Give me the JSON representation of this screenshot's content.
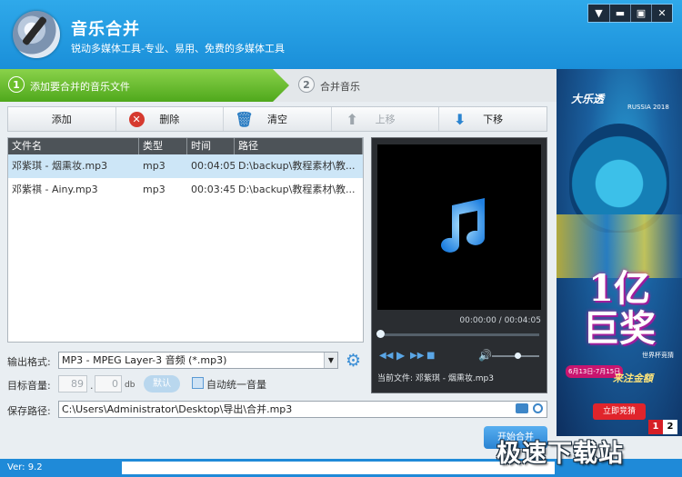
{
  "app": {
    "title": "音乐合并",
    "subtitle": "锐动多媒体工具-专业、易用、免费的多媒体工具"
  },
  "window_controls": {
    "menu_icon": "menu-icon",
    "minimize_icon": "minimize-icon",
    "maximize_icon": "maximize-icon",
    "close_icon": "close-icon"
  },
  "steps": [
    {
      "number": "1",
      "label": "添加要合并的音乐文件",
      "active": true
    },
    {
      "number": "2",
      "label": "合并音乐",
      "active": false
    }
  ],
  "toolbar": {
    "add": "添加",
    "delete": "删除",
    "clear": "清空",
    "move_up": "上移",
    "move_down": "下移"
  },
  "file_list": {
    "headers": [
      "文件名",
      "类型",
      "时间",
      "路径"
    ],
    "rows": [
      {
        "name": "邓紫琪 - 烟熏妆.mp3",
        "type": "mp3",
        "time": "00:04:05",
        "path": "D:\\backup\\教程素材\\教...",
        "selected": true
      },
      {
        "name": "邓紫祺 - Ainy.mp3",
        "type": "mp3",
        "time": "00:03:45",
        "path": "D:\\backup\\教程素材\\教...",
        "selected": false
      }
    ]
  },
  "preview": {
    "time_display": "00:00:00 / 00:04:05",
    "current_file_label": "当前文件: 邓紫琪 - 烟熏妆.mp3",
    "progress": 0,
    "volume": 0.6
  },
  "settings": {
    "output_format_label": "输出格式:",
    "output_format_value": "MP3 - MPEG Layer-3 音频 (*.mp3)",
    "target_volume_label": "目标音量:",
    "volume_int": "89",
    "volume_dec": "0",
    "volume_unit": "db",
    "default_button": "默认",
    "auto_unify_label": "自动统一音量",
    "auto_unify_checked": false,
    "save_path_label": "保存路径:",
    "save_path_value": "C:\\Users\\Administrator\\Desktop\\导出\\合并.mp3",
    "start_button": "开始合并"
  },
  "ad": {
    "logo": "大乐透",
    "event": "RUSSIA 2018",
    "headline": "1亿\n巨奖",
    "dates": "6月13日-7月15日",
    "world_cup": "世界杯竞猜",
    "hint": "来注金額",
    "cta": "立即竞猜",
    "pages": [
      "1",
      "2"
    ]
  },
  "status": {
    "version": "Ver: 9.2"
  },
  "watermark": "极速下载站",
  "colors": {
    "title_bar": "#1a8fd9",
    "step_active": "#6cbf2a",
    "selected_row": "#cde6f7",
    "accent": "#2b84d0"
  }
}
